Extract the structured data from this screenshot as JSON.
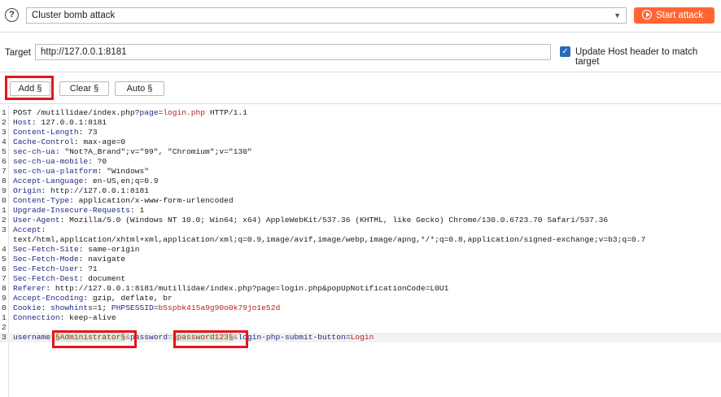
{
  "toolbar": {
    "help_glyph": "?",
    "attack_type": "Cluster bomb attack",
    "start_label": "Start attack",
    "accent_color": "#ff6633"
  },
  "target": {
    "label": "Target",
    "value": "http://127.0.0.1:8181",
    "update_host_label": "Update Host header to match target",
    "update_host_checked": true
  },
  "positions": {
    "add_label": "Add §",
    "clear_label": "Clear §",
    "auto_label": "Auto §"
  },
  "request": {
    "l1": {
      "n": "1",
      "a": "POST /mutillidae/index.php?",
      "b": "page",
      "c": "=",
      "d": "login.php",
      "e": " HTTP/1.1"
    },
    "l2": {
      "n": "2",
      "k": "Host",
      "v": ": 127.0.0.1:8181"
    },
    "l3": {
      "n": "3",
      "k": "Content-Length",
      "v": ": 73"
    },
    "l4": {
      "n": "4",
      "k": "Cache-Control",
      "v": ": max-age=0"
    },
    "l5": {
      "n": "5",
      "k": "sec-ch-ua",
      "v": ": \"Not?A_Brand\";v=\"99\", \"Chromium\";v=\"130\""
    },
    "l6": {
      "n": "6",
      "k": "sec-ch-ua-mobile",
      "v": ": ?0"
    },
    "l7": {
      "n": "7",
      "k": "sec-ch-ua-platform",
      "v": ": \"Windows\""
    },
    "l8": {
      "n": "8",
      "k": "Accept-Language",
      "v": ": en-US,en;q=0.9"
    },
    "l9": {
      "n": "9",
      "k": "Origin",
      "v": ": http://127.0.0.1:8181"
    },
    "l10": {
      "n": "0",
      "k": "Content-Type",
      "v": ": application/x-www-form-urlencoded"
    },
    "l11": {
      "n": "1",
      "k": "Upgrade-Insecure-Requests",
      "v": ": 1"
    },
    "l12": {
      "n": "2",
      "k": "User-Agent",
      "v": ": Mozilla/5.0 (Windows NT 10.0; Win64; x64) AppleWebKit/537.36 (KHTML, like Gecko) Chrome/130.0.6723.70 Safari/537.36"
    },
    "l13": {
      "n": "3",
      "k": "Accept",
      "v": ":"
    },
    "l13b": {
      "v": "text/html,application/xhtml+xml,application/xml;q=0.9,image/avif,image/webp,image/apng,*/*;q=0.8,application/signed-exchange;v=b3;q=0.7"
    },
    "l14": {
      "n": "4",
      "k": "Sec-Fetch-Site",
      "v": ": same-origin"
    },
    "l15": {
      "n": "5",
      "k": "Sec-Fetch-Mode",
      "v": ": navigate"
    },
    "l16": {
      "n": "6",
      "k": "Sec-Fetch-User",
      "v": ": ?1"
    },
    "l17": {
      "n": "7",
      "k": "Sec-Fetch-Dest",
      "v": ": document"
    },
    "l18": {
      "n": "8",
      "k": "Referer",
      "v": ": http://127.0.0.1:8181/mutillidae/index.php?page=login.php&popUpNotificationCode=L0U1"
    },
    "l19": {
      "n": "9",
      "k": "Accept-Encoding",
      "v": ": gzip, deflate, br"
    },
    "l20": {
      "n": "0",
      "k": "Cookie",
      "c1": ": ",
      "ck1": "showhints",
      "c2": "=1; ",
      "ck2": "PHPSESSID",
      "c3": "=",
      "cv": "b5spbk415a9g90o0k79jo1e52d"
    },
    "l21": {
      "n": "1",
      "k": "Connection",
      "v": ": keep-alive"
    },
    "l22": {
      "n": "2"
    },
    "l23": {
      "n": "3",
      "p1": "username",
      "eq1": "=",
      "m1": "§Administrator§",
      "amp1": "&",
      "p2": "password",
      "eq2": "=",
      "m2": "§password123§",
      "amp2": "&",
      "p3": "login-php-submit-button",
      "eq3": "=",
      "v3": "Login"
    }
  }
}
